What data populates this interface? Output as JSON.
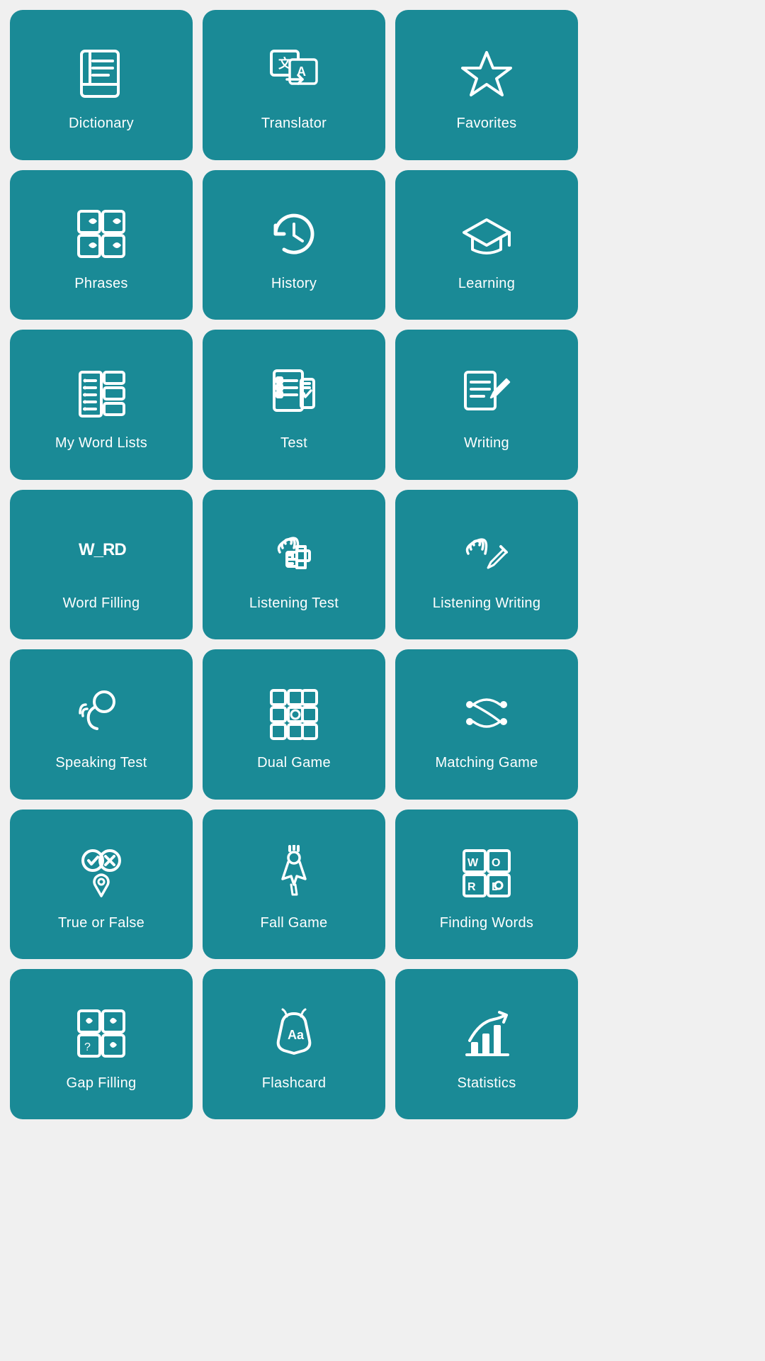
{
  "tiles": [
    {
      "id": "dictionary",
      "label": "Dictionary"
    },
    {
      "id": "translator",
      "label": "Translator"
    },
    {
      "id": "favorites",
      "label": "Favorites"
    },
    {
      "id": "phrases",
      "label": "Phrases"
    },
    {
      "id": "history",
      "label": "History"
    },
    {
      "id": "learning",
      "label": "Learning"
    },
    {
      "id": "my-word-lists",
      "label": "My Word Lists"
    },
    {
      "id": "test",
      "label": "Test"
    },
    {
      "id": "writing",
      "label": "Writing"
    },
    {
      "id": "word-filling",
      "label": "Word Filling"
    },
    {
      "id": "listening-test",
      "label": "Listening Test"
    },
    {
      "id": "listening-writing",
      "label": "Listening Writing"
    },
    {
      "id": "speaking-test",
      "label": "Speaking Test"
    },
    {
      "id": "dual-game",
      "label": "Dual Game"
    },
    {
      "id": "matching-game",
      "label": "Matching Game"
    },
    {
      "id": "true-or-false",
      "label": "True or False"
    },
    {
      "id": "fall-game",
      "label": "Fall Game"
    },
    {
      "id": "finding-words",
      "label": "Finding Words"
    },
    {
      "id": "gap-filling",
      "label": "Gap Filling"
    },
    {
      "id": "flashcard",
      "label": "Flashcard"
    },
    {
      "id": "statistics",
      "label": "Statistics"
    }
  ]
}
